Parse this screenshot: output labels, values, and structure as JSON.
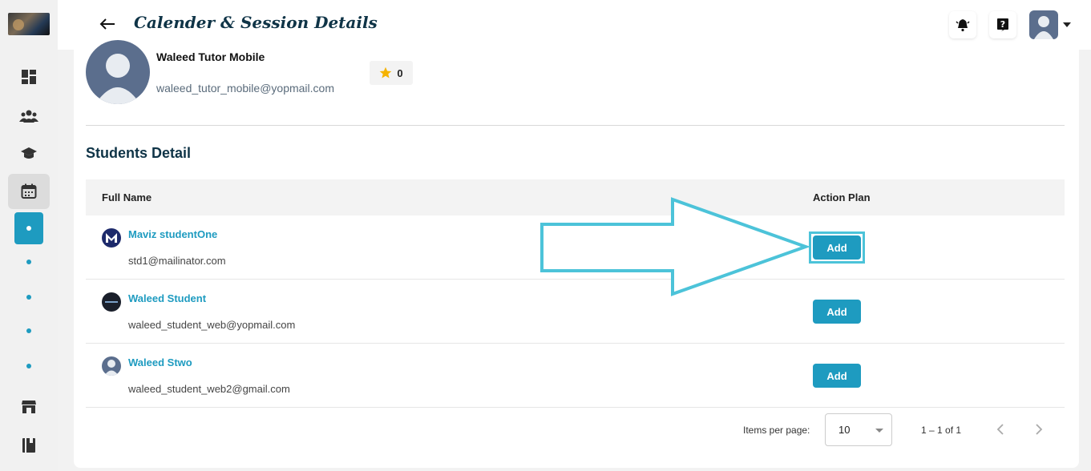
{
  "header": {
    "title": "Calender & Session Details"
  },
  "sidebar": {
    "items": [
      "dashboard-icon",
      "users-icon",
      "graduation-cap-icon",
      "calendar-icon",
      "store-icon",
      "book-icon"
    ]
  },
  "tutor": {
    "name": "Waleed Tutor Mobile",
    "email": "waleed_tutor_mobile@yopmail.com",
    "rating": "0"
  },
  "students": {
    "title": "Students Detail",
    "columns": {
      "name": "Full Name",
      "plan": "Action Plan"
    },
    "rows": [
      {
        "name": "Maviz studentOne",
        "email": "std1@mailinator.com",
        "action": "Add"
      },
      {
        "name": "Waleed Student",
        "email": "waleed_student_web@yopmail.com",
        "action": "Add"
      },
      {
        "name": "Waleed Stwo",
        "email": "waleed_student_web2@gmail.com",
        "action": "Add"
      }
    ]
  },
  "pagination": {
    "items_label": "Items per page:",
    "per_page": "10",
    "range": "1 – 1 of 1"
  },
  "colors": {
    "accent": "#1e9bc0",
    "title": "#0f3447",
    "annotation": "#4cc3d9"
  }
}
